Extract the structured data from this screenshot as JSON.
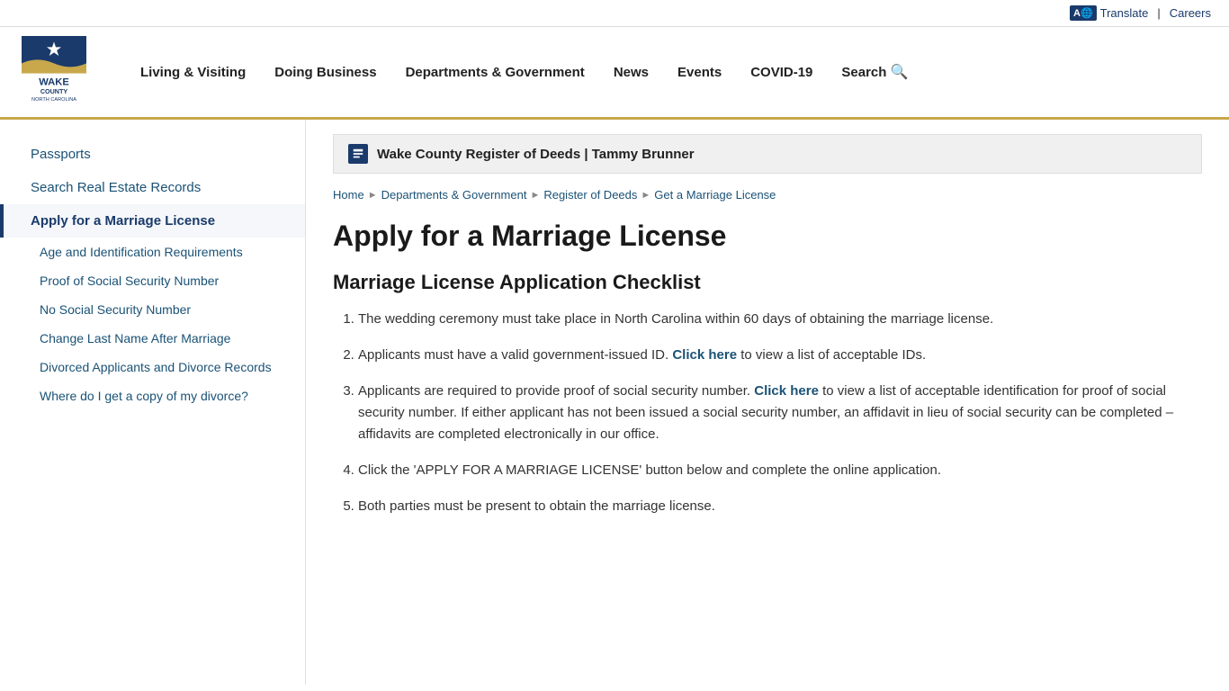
{
  "utility": {
    "translate_label": "Translate",
    "careers_label": "Careers",
    "separator": "|"
  },
  "header": {
    "logo_alt": "Wake County North Carolina",
    "nav_items": [
      {
        "label": "Living & Visiting",
        "href": "#"
      },
      {
        "label": "Doing Business",
        "href": "#"
      },
      {
        "label": "Departments & Government",
        "href": "#"
      },
      {
        "label": "News",
        "href": "#"
      },
      {
        "label": "Events",
        "href": "#"
      },
      {
        "label": "COVID-19",
        "href": "#"
      },
      {
        "label": "Search",
        "href": "#",
        "icon": "search"
      }
    ]
  },
  "sidebar": {
    "items": [
      {
        "label": "Passports",
        "href": "#",
        "active": false,
        "sub": false
      },
      {
        "label": "Search Real Estate Records",
        "href": "#",
        "active": false,
        "sub": false
      },
      {
        "label": "Apply for a Marriage License",
        "href": "#",
        "active": true,
        "sub": false
      },
      {
        "label": "Age and Identification Requirements",
        "href": "#",
        "active": false,
        "sub": true
      },
      {
        "label": "Proof of Social Security Number",
        "href": "#",
        "active": false,
        "sub": true
      },
      {
        "label": "No Social Security Number",
        "href": "#",
        "active": false,
        "sub": true
      },
      {
        "label": "Change Last Name After Marriage",
        "href": "#",
        "active": false,
        "sub": true
      },
      {
        "label": "Divorced Applicants and Divorce Records",
        "href": "#",
        "active": false,
        "sub": true
      },
      {
        "label": "Where do I get a copy of my divorce?",
        "href": "#",
        "active": false,
        "sub": true
      }
    ]
  },
  "dept_banner": {
    "text": "Wake County Register of Deeds | Tammy Brunner"
  },
  "breadcrumb": {
    "items": [
      {
        "label": "Home",
        "href": "#"
      },
      {
        "label": "Departments & Government",
        "href": "#"
      },
      {
        "label": "Register of Deeds",
        "href": "#"
      },
      {
        "label": "Get a Marriage License",
        "href": "#"
      }
    ]
  },
  "page_title": "Apply for a Marriage License",
  "section_title": "Marriage License Application Checklist",
  "checklist_items": [
    {
      "id": 1,
      "text": "The wedding ceremony must take place in North Carolina within 60 days of obtaining the marriage license.",
      "link": null,
      "link_text": null,
      "link_after": null
    },
    {
      "id": 2,
      "text_before": "Applicants must have a valid government-issued ID.",
      "link_text": "Click here",
      "text_after": "to view a list of acceptable IDs.",
      "link": "#"
    },
    {
      "id": 3,
      "text_before": "Applicants are required to provide proof of social security number.",
      "link_text": "Click here",
      "text_after": "to view a list of acceptable identification for proof of social security number. If either applicant has not been issued a social security number, an affidavit in lieu of social security can be completed – affidavits are completed electronically in our office.",
      "link": "#"
    },
    {
      "id": 4,
      "text": "Click the 'APPLY FOR A MARRIAGE LICENSE' button below and complete the online application.",
      "link": null
    },
    {
      "id": 5,
      "text": "Both parties must be present to obtain the marriage license.",
      "link": null
    }
  ]
}
